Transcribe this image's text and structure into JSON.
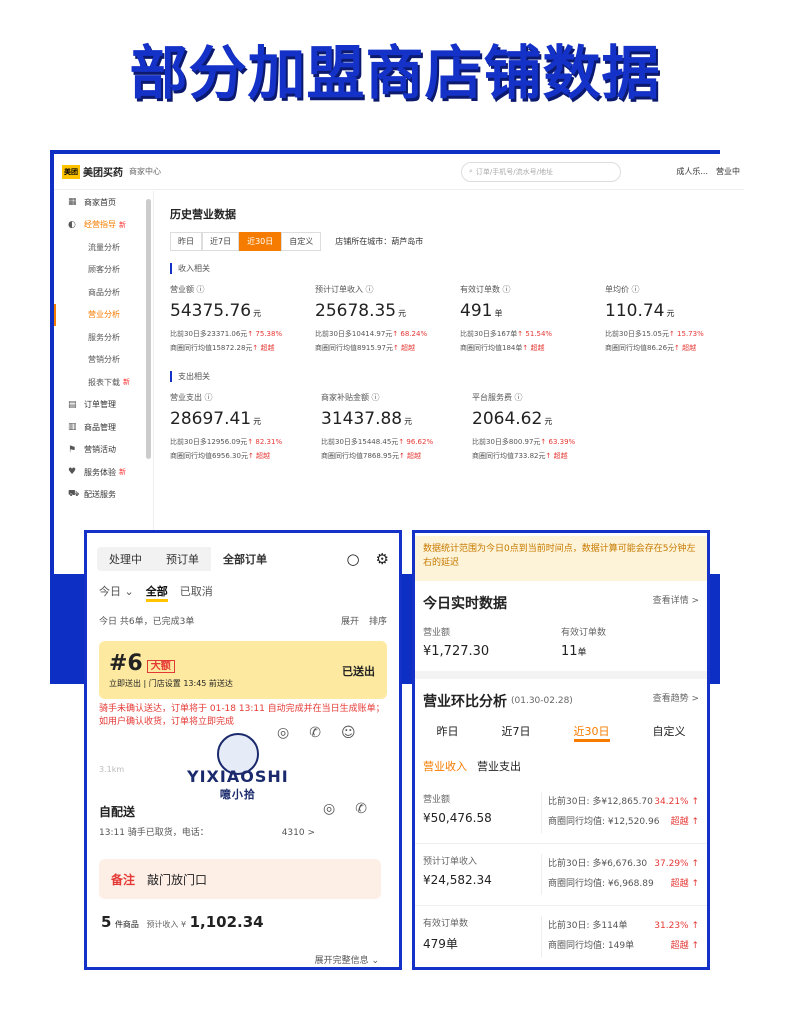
{
  "page_title": "部分加盟商店铺数据",
  "desktop": {
    "logo_badge": "美团",
    "logo_text": "美团买药",
    "logo_sub": "商家中心",
    "search_placeholder": "订单/手机号/流水号/地址",
    "top_right": [
      "成人乐...",
      "营业中"
    ],
    "sidebar": [
      {
        "label": "商家首页",
        "icon": "home-icon"
      },
      {
        "label": "经营指导",
        "icon": "chart-icon",
        "active": true,
        "badge": "新"
      },
      {
        "label": "流量分析",
        "sub": true
      },
      {
        "label": "顾客分析",
        "sub": true
      },
      {
        "label": "商品分析",
        "sub": true
      },
      {
        "label": "营业分析",
        "sub": true,
        "current": true
      },
      {
        "label": "服务分析",
        "sub": true
      },
      {
        "label": "营销分析",
        "sub": true
      },
      {
        "label": "报表下载",
        "sub": true,
        "badge": "新"
      },
      {
        "label": "订单管理",
        "icon": "order-icon"
      },
      {
        "label": "商品管理",
        "icon": "goods-icon"
      },
      {
        "label": "营销活动",
        "icon": "promo-icon"
      },
      {
        "label": "服务体验",
        "icon": "service-icon",
        "badge": "新"
      },
      {
        "label": "配送服务",
        "icon": "delivery-icon"
      }
    ],
    "heading": "历史营业数据",
    "tabs": [
      "昨日",
      "近7日",
      "近30日",
      "自定义"
    ],
    "active_tab": "近30日",
    "city": "店铺所在城市：葫芦岛市",
    "income_section": "收入相关",
    "income": [
      {
        "label": "营业额",
        "value": "54375.76",
        "unit": "元",
        "cmp": "比前30日多23371.06元",
        "pct": "↑ 75.38%",
        "avg": "商圈同行均值15872.28元",
        "ex": "↑ 超越"
      },
      {
        "label": "预计订单收入",
        "value": "25678.35",
        "unit": "元",
        "cmp": "比前30日多10414.97元",
        "pct": "↑ 68.24%",
        "avg": "商圈同行均值8915.97元",
        "ex": "↑ 超越"
      },
      {
        "label": "有效订单数",
        "value": "491",
        "unit": "单",
        "cmp": "比前30日多167单",
        "pct": "↑ 51.54%",
        "avg": "商圈同行均值184单",
        "ex": "↑ 超越"
      },
      {
        "label": "单均价",
        "value": "110.74",
        "unit": "元",
        "cmp": "比前30日多15.05元",
        "pct": "↑ 15.73%",
        "avg": "商圈同行均值86.26元",
        "ex": "↑ 超越"
      }
    ],
    "expense_section": "支出相关",
    "expense": [
      {
        "label": "营业支出",
        "value": "28697.41",
        "unit": "元",
        "cmp": "比前30日多12956.09元",
        "pct": "↑ 82.31%",
        "avg": "商圈同行均值6956.30元",
        "ex": "↑ 超越"
      },
      {
        "label": "商家补贴金额",
        "value": "31437.88",
        "unit": "元",
        "cmp": "比前30日多15448.45元",
        "pct": "↑ 96.62%",
        "avg": "商圈同行均值7868.95元",
        "ex": "↑ 超越"
      },
      {
        "label": "平台服务费",
        "value": "2064.62",
        "unit": "元",
        "cmp": "比前30日多800.97元",
        "pct": "↑ 63.39%",
        "avg": "商圈同行均值733.82元",
        "ex": "↑ 超越"
      }
    ]
  },
  "left_phone": {
    "segments": [
      "处理中",
      "预订单",
      "全部订单"
    ],
    "active_segment": "全部订单",
    "filters": [
      "今日 ⌄",
      "全部",
      "已取消"
    ],
    "stat": "今日 共6单，已完成3单",
    "expand": "展开",
    "sort": "排序",
    "order_no": "#6",
    "big_tag": "大额",
    "order_info": "立即送出 | 门店设置 13:45 前送达",
    "order_status": "已送出",
    "warning": "骑手未确认送达，订单将于 01-18 13:11 自动完成并在当日生成账单；如用户确认收货，订单将立即完成",
    "distance": "3.1km",
    "watermark_en": "YIXIAOSHI",
    "watermark_cn": "噫小拾",
    "pickup_title": "自配送",
    "pickup_info": "13:11  骑手已取货，电话：",
    "pickup_tail": "4310 >",
    "note_label": "备注",
    "note_text": "敲门放门口",
    "total_count": "5",
    "total_unit": "件商品",
    "total_label": "预计收入 ¥",
    "total_value": "1,102.34",
    "more": "展开完整信息 ⌄"
  },
  "right_phone": {
    "warning": "数据统计范围为今日0点到当前时间点，数据计算可能会存在5分钟左右的延迟",
    "realtime_title": "今日实时数据",
    "realtime_link": "查看详情 >",
    "realtime": [
      {
        "label": "营业额",
        "value": "¥1,727.30"
      },
      {
        "label": "有效订单数",
        "value": "11",
        "unit": "单"
      }
    ],
    "ratio_title": "营业环比分析",
    "ratio_range": "(01.30-02.28)",
    "ratio_link": "查看趋势 >",
    "tabs": [
      "昨日",
      "近7日",
      "近30日",
      "自定义"
    ],
    "active_tab": "近30日",
    "subtabs": [
      "营业收入",
      "营业支出"
    ],
    "rows": [
      {
        "label": "营业额",
        "value": "¥50,476.58",
        "cmp": "比前30日: 多¥12,865.70",
        "pct": "34.21% ↑",
        "avg": "商圈同行均值: ¥12,520.96",
        "ex": "超越 ↑"
      },
      {
        "label": "预计订单收入",
        "value": "¥24,582.34",
        "cmp": "比前30日: 多¥6,676.30",
        "pct": "37.29% ↑",
        "avg": "商圈同行均值: ¥6,968.89",
        "ex": "超越 ↑"
      },
      {
        "label": "有效订单数",
        "value": "479单",
        "cmp": "比前30日: 多114单",
        "pct": "31.23% ↑",
        "avg": "商圈同行均值: 149单",
        "ex": "超越 ↑"
      }
    ]
  }
}
